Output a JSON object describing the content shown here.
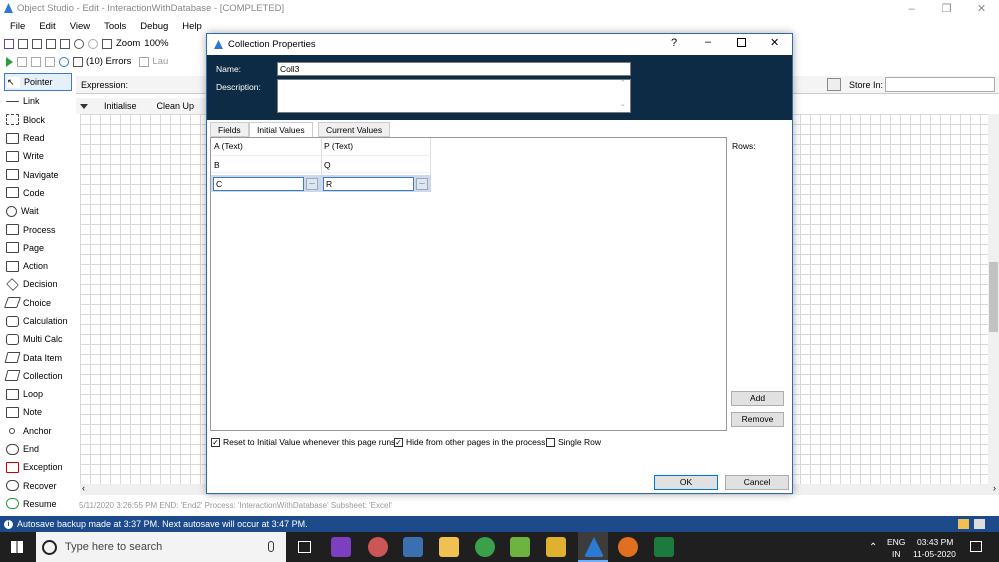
{
  "window": {
    "title": "Object Studio - Edit - InteractionWithDatabase - [COMPLETED]",
    "menu": [
      "File",
      "Edit",
      "View",
      "Tools",
      "Debug",
      "Help"
    ],
    "zoom_label": "Zoom",
    "zoom_value": "100%",
    "errors_label": "(10) Errors",
    "launch_label": "Lau",
    "expression_label": "Expression:",
    "store_in_label": "Store In:",
    "stage_tabs": [
      "Initialise",
      "Clean Up"
    ]
  },
  "palette": [
    "Pointer",
    "Link",
    "Block",
    "Read",
    "Write",
    "Navigate",
    "Code",
    "Wait",
    "Process",
    "Page",
    "Action",
    "Decision",
    "Choice",
    "Calculation",
    "Multi Calc",
    "Data Item",
    "Collection",
    "Loop",
    "Note",
    "Anchor",
    "End",
    "Exception",
    "Recover",
    "Resume"
  ],
  "log_line": "5/11/2020 3:26:55 PM END: 'End2' Process: 'InteractionWithDatabase' Subsheet: 'Excel'",
  "status": "Autosave backup made at 3:37 PM. Next autosave will occur at 3:47 PM.",
  "dialog": {
    "title": "Collection Properties",
    "help": "?",
    "name_label": "Name:",
    "name_value": "Coll3",
    "description_label": "Description:",
    "description_value": "",
    "tabs": [
      "Fields",
      "Initial Values",
      "Current Values"
    ],
    "active_tab": "Initial Values",
    "grid": {
      "columns": [
        "A  (Text)",
        "P  (Text)"
      ],
      "rows": [
        [
          "B",
          "Q"
        ]
      ],
      "edit_row": [
        "C",
        "R"
      ]
    },
    "rows_label": "Rows:",
    "add_label": "Add",
    "remove_label": "Remove",
    "options": [
      {
        "label": "Reset to Initial Value whenever this page runs",
        "checked": true
      },
      {
        "label": "Hide from other pages in the process",
        "checked": true
      },
      {
        "label": "Single Row",
        "checked": false
      }
    ],
    "ok_label": "OK",
    "cancel_label": "Cancel"
  },
  "taskbar": {
    "search_placeholder": "Type here to search",
    "lang": "ENG",
    "region": "IN",
    "time": "03:43 PM",
    "date": "11-05-2020"
  },
  "colors": {
    "dialog_header": "#0d2b45",
    "status_bar": "#1c4a8a",
    "taskbar": "#1f1f1f"
  }
}
